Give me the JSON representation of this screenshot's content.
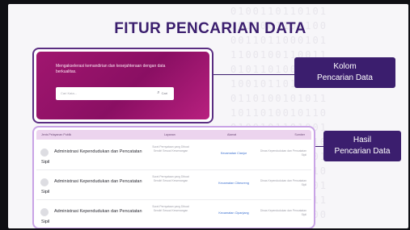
{
  "slide": {
    "title": "FITUR PENCARIAN DATA",
    "background_binary": "0100110110101\n1010001101100\n0011011000101\n1100100110011\n0101101001010\n1001011011100\n0110100101011\n1011010010110\n0100101101001\n1101001010110\n0010110101001\n1011001011010\n0101100110101\n1010011001011\n0110101100100"
  },
  "search": {
    "description": "Mengakselerasi kemandirian dan kesejahteraan dengan data berkualitas.",
    "placeholder": "Cari Kata...",
    "button_label": "Cari",
    "button_icon": "search-icon"
  },
  "callouts": {
    "search_label_1": "Kolom",
    "search_label_2": "Pencarian Data",
    "results_label_1": "Hasil",
    "results_label_2": "Pencarian Data"
  },
  "results": {
    "columns": [
      "Jenis Pelayanan Publik",
      "Layanan",
      "Alamat",
      "Sumber"
    ],
    "rows": [
      {
        "name_line1": "Administrasi Kependudukan dan Pencatatan",
        "name_line2": "Sipil",
        "layanan": "Surat Pernyataan yang Dibuat Sendiri Sesuai Kewenangan",
        "alamat": "Kecamatan Cianjur",
        "sumber": "Dinas Kependudukan dan Pencatatan Sipil"
      },
      {
        "name_line1": "Administrasi Kependudukan dan Pencatatan",
        "name_line2": "Sipil",
        "layanan": "Surat Pernyataan yang Dibuat Sendiri Sesuai Kewenangan",
        "alamat": "Kecamatan Cibeureng",
        "sumber": "Dinas Kependudukan dan Pencatatan Sipil"
      },
      {
        "name_line1": "Administrasi Kependudukan dan Pencatatan",
        "name_line2": "Sipil",
        "layanan": "Surat Pernyataan yang Dibuat Sendiri Sesuai Kewenangan",
        "alamat": "Kecamatan Cipanjang",
        "sumber": "Dinas Kependudukan dan Pencatatan Sipil"
      }
    ]
  },
  "colors": {
    "title": "#3b1e6e",
    "callout_bg": "#3b1e6e",
    "search_card": "#a0166f",
    "results_border": "#c9a3e6",
    "link": "#3a6fd0"
  }
}
